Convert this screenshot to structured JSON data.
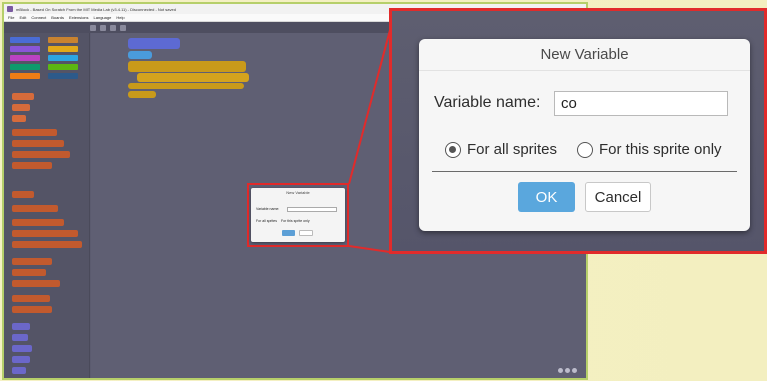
{
  "app": {
    "title": "mBlock - Based On Scratch From the MIT Media Lab (v3.4.11) - Disconnected - Not saved",
    "menu": [
      "File",
      "Edit",
      "Connect",
      "Boards",
      "Extensions",
      "Language",
      "Help"
    ]
  },
  "dialog": {
    "title": "New Variable",
    "name_label": "Variable name:",
    "name_value": "co",
    "option_all": "For all sprites",
    "option_this": "For this sprite only",
    "selected_option": "For all sprites",
    "ok_label": "OK",
    "cancel_label": "Cancel"
  },
  "colors": {
    "highlight_red": "#e12b2b",
    "ok_blue": "#5aa7dd",
    "editor_bg": "#5f5f73",
    "page_bg": "#f5f1c4"
  }
}
